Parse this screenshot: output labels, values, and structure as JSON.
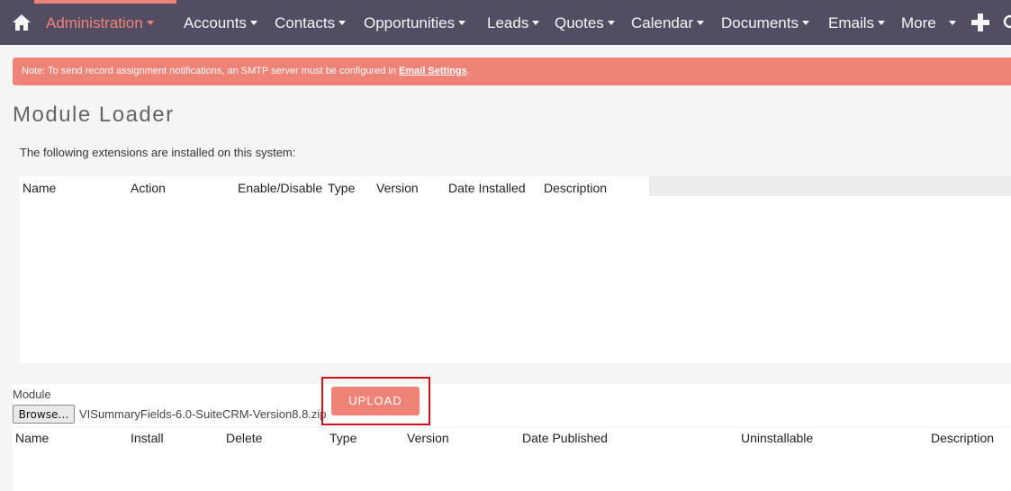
{
  "nav": {
    "items": [
      {
        "label": "Administration",
        "active": true
      },
      {
        "label": "Accounts"
      },
      {
        "label": "Contacts"
      },
      {
        "label": "Opportunities"
      },
      {
        "label": "Leads"
      },
      {
        "label": "Quotes"
      },
      {
        "label": "Calendar"
      },
      {
        "label": "Documents"
      },
      {
        "label": "Emails"
      },
      {
        "label": "More"
      }
    ],
    "home_icon": "home-icon",
    "plus_icon": "plus-icon"
  },
  "alert": {
    "text": "Note: To send record assignment notifications, an SMTP server must be configured in ",
    "link": "Email Settings",
    "suffix": "."
  },
  "page_title": "Module Loader",
  "intro": "The following extensions are installed on this system:",
  "installed_table": {
    "headers": [
      "Name",
      "Action",
      "Enable/Disable",
      "Type",
      "Version",
      "Date Installed",
      "Description"
    ]
  },
  "upload": {
    "module_label": "Module",
    "browse_label": "Browse…",
    "file_name": "VISummaryFields-6.0-SuiteCRM-Version8.8.zip",
    "upload_label": "UPLOAD"
  },
  "package_table": {
    "headers": [
      "Name",
      "Install",
      "Delete",
      "Type",
      "Version",
      "Date Published",
      "Uninstallable",
      "Description"
    ]
  },
  "colors": {
    "nav_bg": "#534d64",
    "accent": "#f08377",
    "highlight": "#d0111b"
  }
}
